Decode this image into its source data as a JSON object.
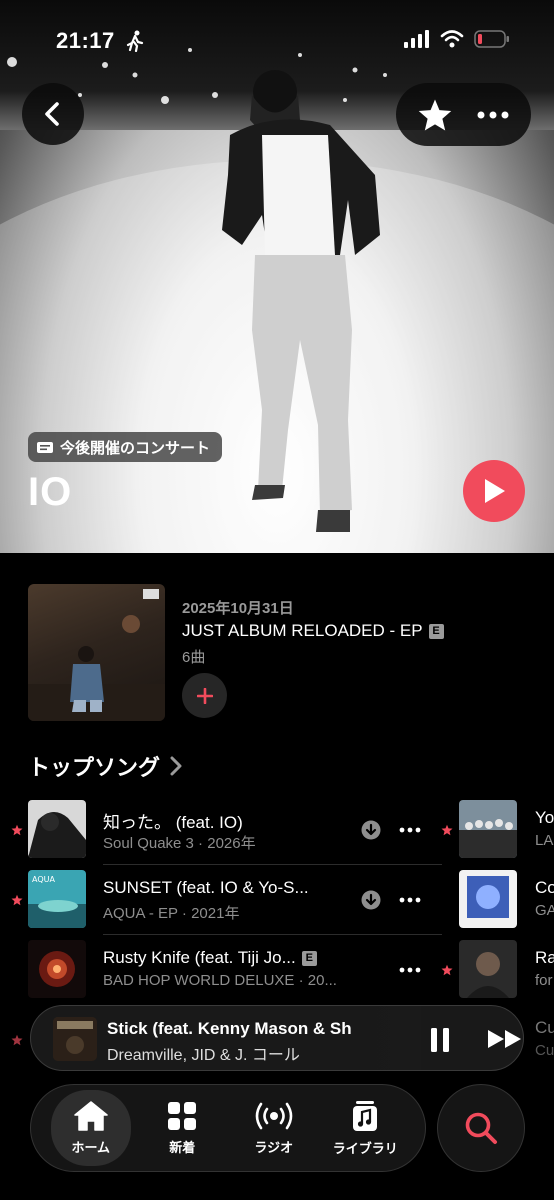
{
  "status_bar": {
    "time": "21:17"
  },
  "header": {
    "back_icon": "chevron-left-icon",
    "favorite_icon": "star-icon",
    "more_icon": "ellipsis-icon"
  },
  "hero": {
    "concert_label": "今後開催のコンサート",
    "artist_name": "IO"
  },
  "latest_release": {
    "date": "2025年10月31日",
    "title": "JUST ALBUM RELOADED - EP",
    "explicit": "E",
    "track_count": "6曲"
  },
  "top_songs": {
    "heading": "トップソング",
    "items": [
      {
        "title": "知った。 (feat. IO)",
        "subtitle": "Soul Quake 3 · 2026年",
        "explicit": false,
        "favorited": true,
        "downloaded": true
      },
      {
        "title": "SUNSET (feat. IO & Yo-S...",
        "subtitle": "AQUA - EP · 2021年",
        "explicit": false,
        "favorited": true,
        "downloaded": true
      },
      {
        "title": "Rusty Knife (feat. Tiji Jo...",
        "subtitle": "BAD HOP WORLD DELUXE · 20...",
        "explicit": true,
        "favorited": false,
        "downloaded": false
      }
    ],
    "column2": [
      {
        "title": "Yo",
        "subtitle": "LA",
        "favorited": true
      },
      {
        "title": "Co",
        "subtitle": "GA",
        "favorited": false
      },
      {
        "title": "Ra",
        "subtitle": "for",
        "favorited": true
      },
      {
        "title": "Cu",
        "subtitle": "Cu",
        "favorited": false
      }
    ],
    "explicit_mark": "E"
  },
  "mini_player": {
    "title": "Stick (feat. Kenny Mason & Sh",
    "artist": "Dreamville, JID & J. コール"
  },
  "tab_bar": {
    "tabs": [
      {
        "label": "ホーム",
        "icon": "home-icon"
      },
      {
        "label": "新着",
        "icon": "grid-icon"
      },
      {
        "label": "ラジオ",
        "icon": "radio-icon"
      },
      {
        "label": "ライブラリ",
        "icon": "library-icon"
      }
    ],
    "search_icon": "search-icon"
  },
  "colors": {
    "accent": "#f14b5c",
    "background": "#000000",
    "secondary_text": "#8e8e8e"
  }
}
